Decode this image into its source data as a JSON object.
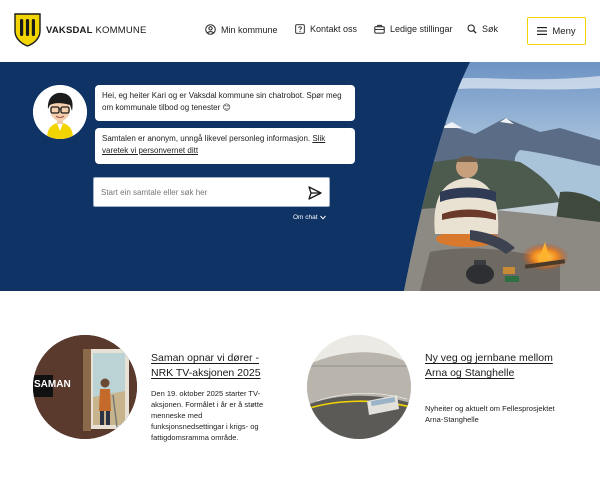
{
  "header": {
    "logo_bold": "VAKSDAL",
    "logo_light": "KOMMUNE",
    "nav": [
      {
        "label": "Min kommune",
        "icon": "user-circle-icon"
      },
      {
        "label": "Kontakt oss",
        "icon": "question-square-icon"
      },
      {
        "label": "Ledige stillingar",
        "icon": "briefcase-icon"
      },
      {
        "label": "Søk",
        "icon": "search-icon"
      }
    ],
    "menu_label": "Meny"
  },
  "hero": {
    "bubble_1": "Hei, eg heiter Kari og er Vaksdal kommune sin chatrobot. Spør meg om kommunale tilbod og tenester 😊",
    "bubble_2_text": "Samtalen er anonym, unngå likevel personleg informasjon. ",
    "bubble_2_link": "Slik varetek vi personvernet ditt",
    "input_placeholder": "Start ein samtale eller søk her",
    "about_chat": "Om chat"
  },
  "cards": [
    {
      "title": "Saman opnar vi dører - NRK TV-aksjonen 2025",
      "description": "Den 19. oktober 2025 starter TV-aksjonen. Formålet i år er å støtte menneske med funksjonsnedsettingar i krigs- og fattigdomsramma område.",
      "image_text": "SAMAN"
    },
    {
      "title": "Ny veg og jernbane mellom Arna og Stanghelle",
      "description": "Nyheiter og aktuelt om Fellesprosjektet Arna-Stanghelle"
    }
  ],
  "colors": {
    "hero_bg": "#0e3364",
    "accent_yellow": "#f2d500",
    "text": "#1a1a1a"
  }
}
